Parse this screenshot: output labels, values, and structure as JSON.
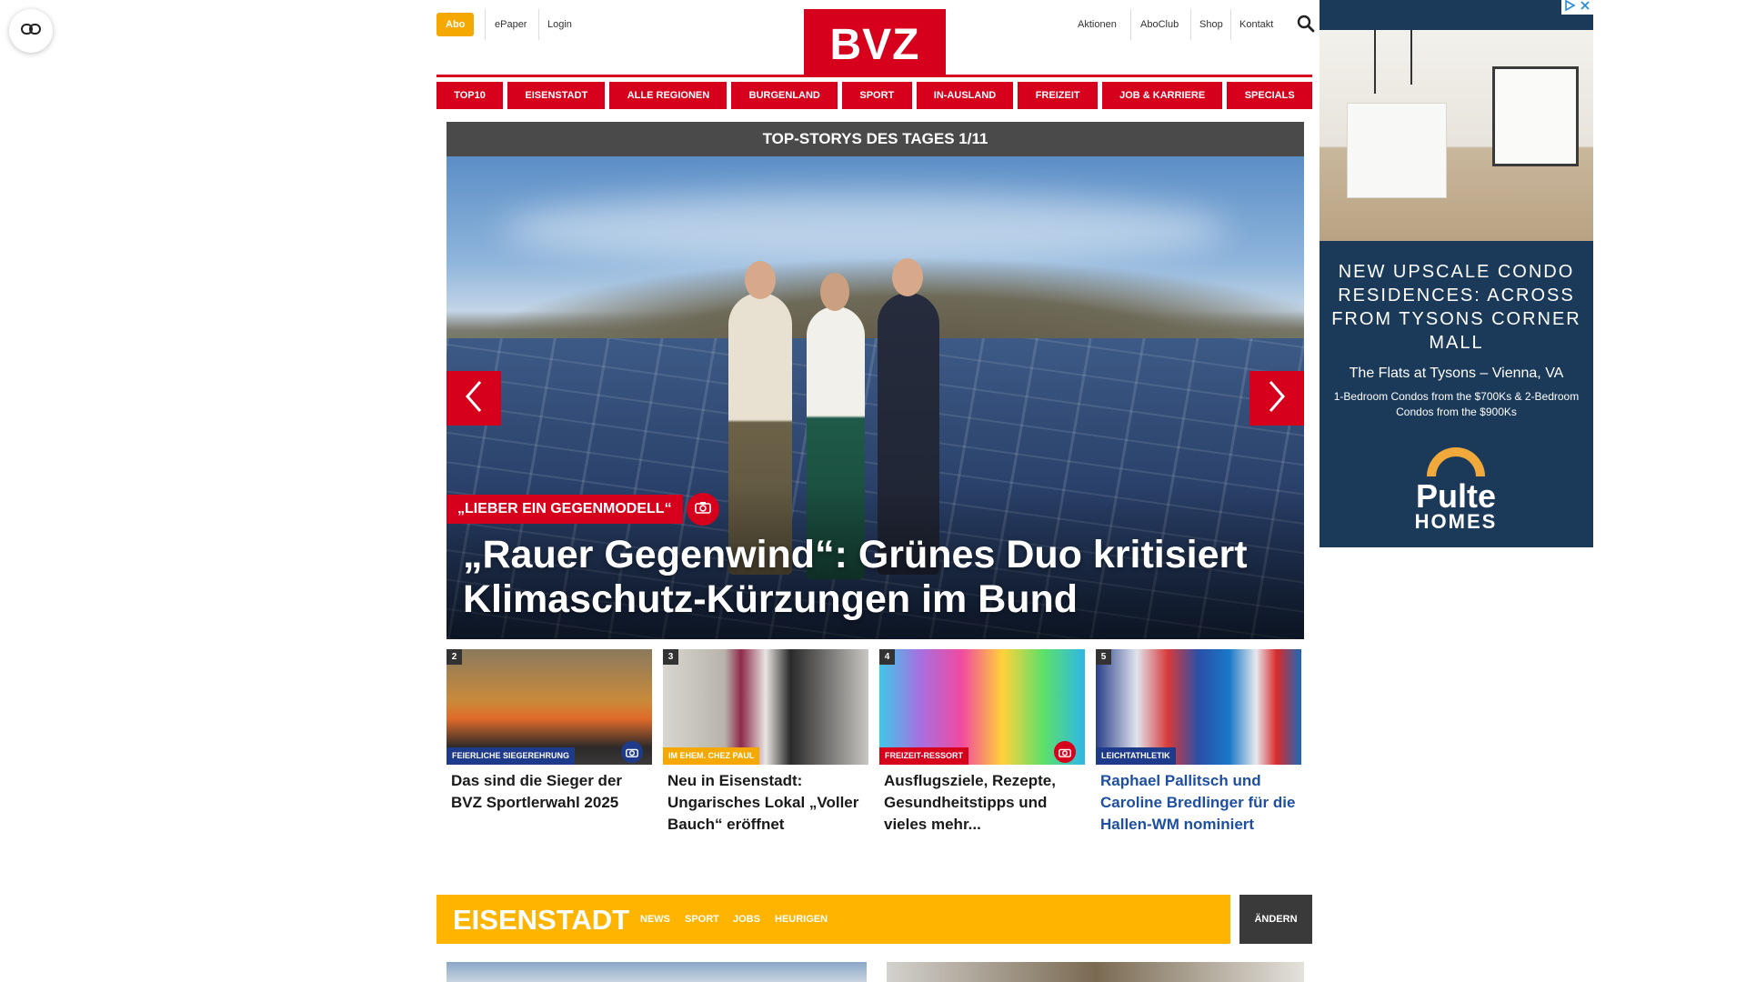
{
  "header": {
    "abo": "Abo",
    "links_left": [
      "ePaper",
      "Login"
    ],
    "logo": "BVZ",
    "links_right": [
      "Aktionen",
      "AboClub",
      "Shop",
      "Kontakt"
    ]
  },
  "nav": {
    "items": [
      "TOP10",
      "EISENSTADT",
      "ALLE REGIONEN",
      "BURGENLAND",
      "SPORT",
      "IN-AUSLAND",
      "FREIZEIT",
      "JOB & KARRIERE",
      "SPECIALS"
    ]
  },
  "top_stories": {
    "heading": "TOP-STORYS DES TAGES 1/11",
    "hero_tag": "„LIEBER EIN GEGENMODELL“",
    "hero_title": "„Rauer Gegenwind“: Grünes Duo kritisiert Klimaschutz-Kürzungen im Bund"
  },
  "cards": [
    {
      "rank": "2",
      "tag": "FEIERLICHE SIEGEREHRUNG",
      "tag_color": "#1e3a8a",
      "title": "Das sind die Sieger der BVZ Sportlerwahl 2025",
      "title_color": "#1a1a1a",
      "camera": true,
      "cam_color": "#1e3a8a"
    },
    {
      "rank": "3",
      "tag": "IM EHEM. CHEZ PAUL",
      "tag_color": "#f5a800",
      "title": "Neu in Eisenstadt: Ungarisches Lokal „Voller Bauch“ eröffnet",
      "title_color": "#1a1a1a",
      "camera": false
    },
    {
      "rank": "4",
      "tag": "FREIZEIT-RESSORT",
      "tag_color": "#d6001c",
      "title": "Ausflugsziele, Rezepte, Gesundheitstipps und vieles mehr...",
      "title_color": "#1a1a1a",
      "camera": true,
      "cam_color": "#d6001c"
    },
    {
      "rank": "5",
      "tag": "LEICHTATHLETIK",
      "tag_color": "#1e3a8a",
      "title": "Raphael Pallitsch und Caroline Bredlinger für die Hallen-WM nominiert",
      "title_color": "#1e4fa0",
      "camera": false
    }
  ],
  "region": {
    "name": "EISENSTADT",
    "links": [
      "NEWS",
      "SPORT",
      "JOBS",
      "HEURIGEN"
    ],
    "change": "ÄNDERN"
  },
  "ad": {
    "headline": "NEW UPSCALE CONDO RESIDENCES: ACROSS FROM TYSONS CORNER MALL",
    "sub": "The Flats at Tysons – Vienna, VA",
    "small": "1-Bedroom Condos from the $700Ks & 2-Bedroom Condos from the $900Ks",
    "brand_line1": "Pulte",
    "brand_line2": "HOMES"
  },
  "colors": {
    "brand_red": "#d6001c",
    "region_yellow": "#ffb400",
    "abo_orange": "#f5a800"
  },
  "icons": [
    "reader-mode-icon",
    "search-icon",
    "chevron-left-icon",
    "chevron-right-icon",
    "camera-icon",
    "ad-info-icon",
    "ad-close-icon"
  ]
}
